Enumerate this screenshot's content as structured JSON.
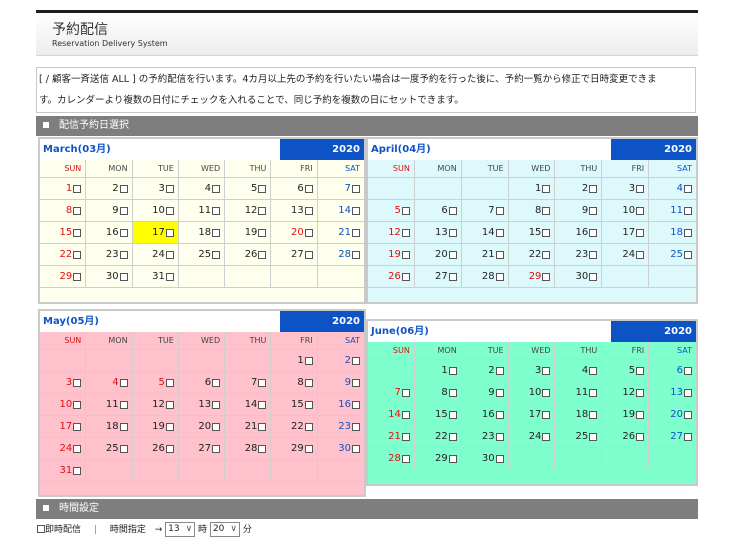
{
  "header": {
    "title": "予約配信",
    "subtitle": "Reservation Delivery System"
  },
  "description": {
    "line1": "[ / 顧客一斉送信 ALL ] の予約配信を行います。4カ月以上先の予約を行いたい場合は一度予約を行った後に、予約一覧から修正で日時変更できま",
    "line2": "す。カレンダーより複数の日付にチェックを入れることで、同じ予約を複数の日にセットできます。"
  },
  "sections": {
    "date_select": "配信予約日選択",
    "time_setting": "時間設定"
  },
  "weekdays": [
    "SUN",
    "MON",
    "TUE",
    "WED",
    "THU",
    "FRI",
    "SAT"
  ],
  "colors": {
    "accent": "#0d53c6",
    "march_bg": "#ffffee",
    "april_bg": "#ddf9fb",
    "may_bg": "#ffc2cc",
    "june_bg": "#80ffce",
    "today": "#ffff00",
    "holiday": "#e01010"
  },
  "calendars": [
    {
      "month": "March(03月)",
      "year": "2020",
      "offset": 0,
      "days": 31,
      "holidays": [
        20
      ],
      "today": 17
    },
    {
      "month": "April(04月)",
      "year": "2020",
      "offset": 3,
      "days": 30,
      "holidays": [
        29
      ],
      "today": null
    },
    {
      "month": "May(05月)",
      "year": "2020",
      "offset": 5,
      "days": 31,
      "holidays": [
        4,
        5
      ],
      "today": null
    },
    {
      "month": "June(06月)",
      "year": "2020",
      "offset": 1,
      "days": 30,
      "holidays": [],
      "today": null
    }
  ],
  "time": {
    "immediate_label": "即時配信",
    "separator": "|",
    "specify_label": "時間指定",
    "arrow": "→",
    "hour_value": "13",
    "hour_unit": "時",
    "minute_value": "20",
    "minute_unit": "分"
  }
}
